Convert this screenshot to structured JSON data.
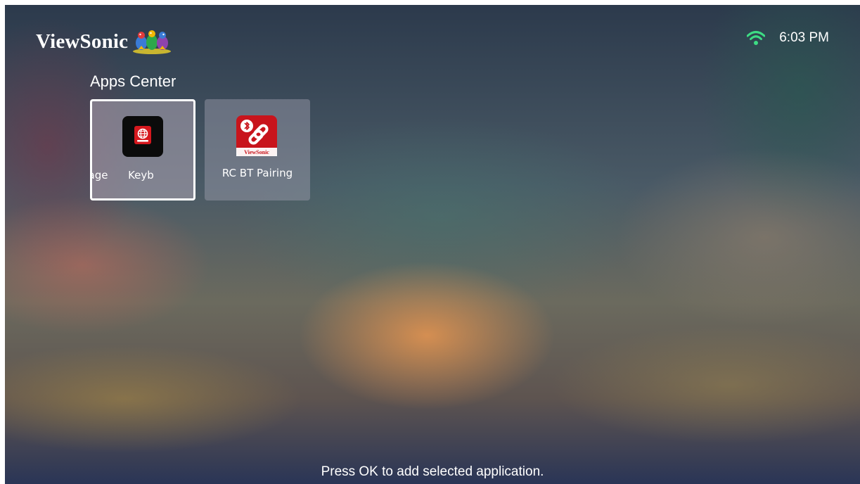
{
  "header": {
    "brand_name": "ViewSonic",
    "time": "6:03 PM",
    "wifi_icon": "wifi-icon",
    "accent_color": "#3ddc84"
  },
  "apps_center": {
    "title": "Apps Center",
    "apps": [
      {
        "label": "Language Keyboard",
        "visible_label": "nguage      Keyb",
        "icon": "globe-icon",
        "selected": true
      },
      {
        "label": "RC BT Pairing",
        "icon": "bt-pairing-icon",
        "selected": false
      }
    ]
  },
  "hint": "Press OK to add selected application."
}
